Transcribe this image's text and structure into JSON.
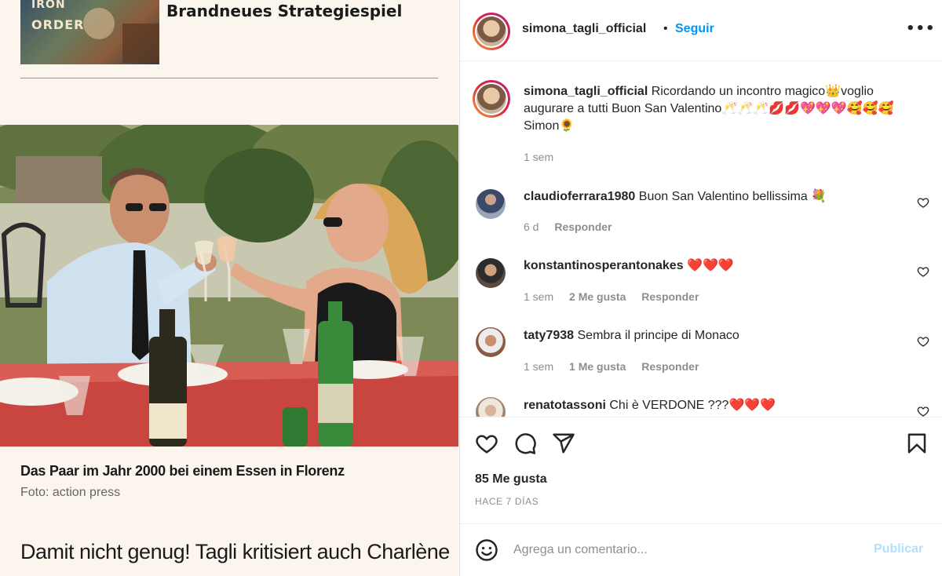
{
  "article": {
    "teaser_thumb_text_1": "IRON",
    "teaser_thumb_text_2": "ORDER",
    "teaser_title": "Brandneues Strategiespiel",
    "caption": "Das Paar im Jahr 2000 bei einem Essen in Florenz",
    "credit": "Foto: action press",
    "subhead": "Damit nicht genug! Tagli kritisiert auch Charlène"
  },
  "post": {
    "username": "simona_tagli_official",
    "separator": "•",
    "follow_label": "Seguir",
    "more_label": "•••",
    "caption_username": "simona_tagli_official",
    "caption_text": "Ricordando un incontro magico👑voglio augurare a tutti Buon San Valentino🥂🥂🥂💋💋💖💖💖🥰🥰🥰 Simon🌻",
    "caption_time": "1 sem",
    "comments": [
      {
        "username": "claudioferrara1980",
        "text": "Buon San Valentino bellissima 💐",
        "time": "6 d",
        "likes": "",
        "reply": "Responder"
      },
      {
        "username": "konstantinosperantonakes",
        "text": "❤️❤️❤️",
        "time": "1 sem",
        "likes": "2 Me gusta",
        "reply": "Responder"
      },
      {
        "username": "taty7938",
        "text": "Sembra il principe di Monaco",
        "time": "1 sem",
        "likes": "1 Me gusta",
        "reply": "Responder"
      },
      {
        "username": "renatotassoni",
        "text": "Chi è VERDONE ???❤️❤️❤️",
        "time": "",
        "likes": "",
        "reply": ""
      }
    ],
    "likes_count": "85 Me gusta",
    "posted_ago": "HACE 7 DÍAS",
    "comment_placeholder": "Agrega un comentario...",
    "publish_label": "Publicar"
  },
  "icons": {
    "like": "heart-icon",
    "comment": "comment-icon",
    "share": "share-icon",
    "save": "bookmark-icon",
    "emoji": "emoji-icon",
    "comment_like": "heart-icon"
  },
  "colors": {
    "link_blue": "#0095f6",
    "publish_disabled": "#b2dffc",
    "muted_text": "#8e8e8e"
  }
}
